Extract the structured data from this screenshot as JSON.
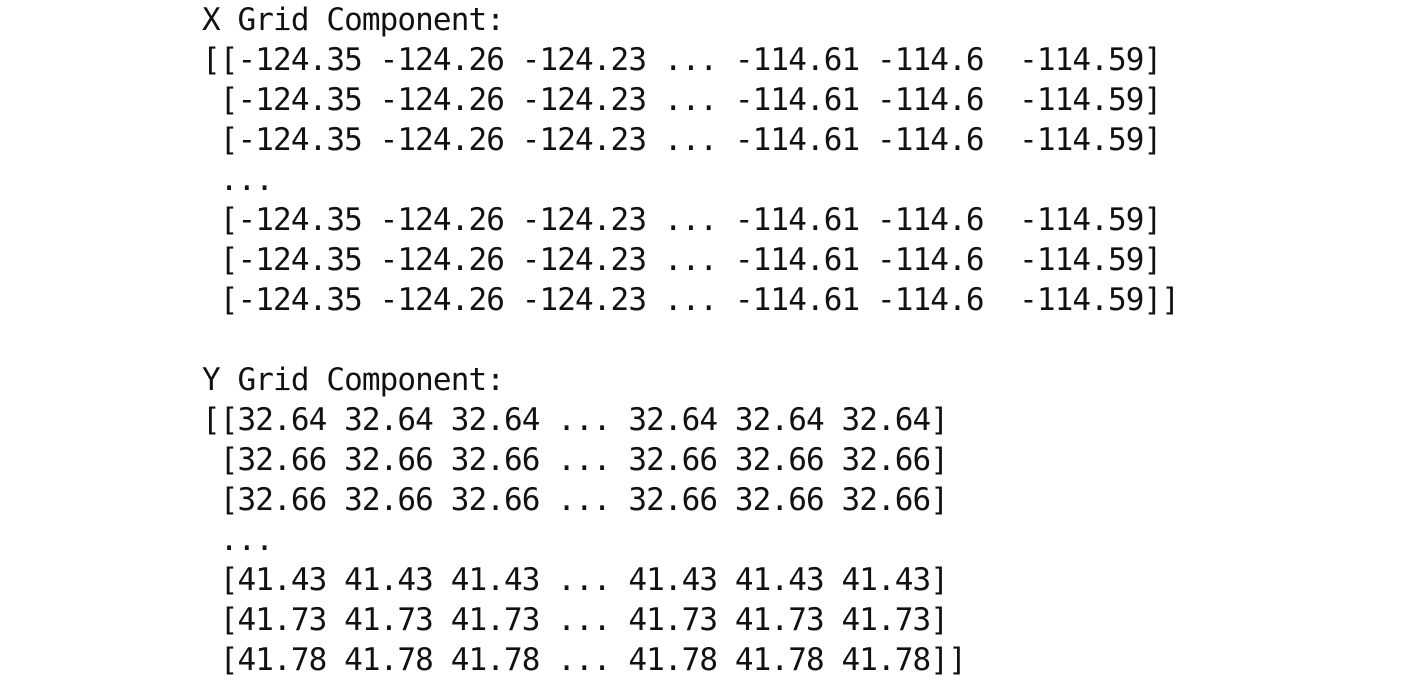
{
  "output": {
    "x_grid": {
      "heading": "X Grid Component:",
      "lines": [
        "[[-124.35 -124.26 -124.23 ... -114.61 -114.6  -114.59]",
        " [-124.35 -124.26 -124.23 ... -114.61 -114.6  -114.59]",
        " [-124.35 -124.26 -124.23 ... -114.61 -114.6  -114.59]",
        " ...",
        " [-124.35 -124.26 -124.23 ... -114.61 -114.6  -114.59]",
        " [-124.35 -124.26 -124.23 ... -114.61 -114.6  -114.59]",
        " [-124.35 -124.26 -124.23 ... -114.61 -114.6  -114.59]]"
      ]
    },
    "y_grid": {
      "heading": "Y Grid Component:",
      "lines": [
        "[[32.64 32.64 32.64 ... 32.64 32.64 32.64]",
        " [32.66 32.66 32.66 ... 32.66 32.66 32.66]",
        " [32.66 32.66 32.66 ... 32.66 32.66 32.66]",
        " ...",
        " [41.43 41.43 41.43 ... 41.43 41.43 41.43]",
        " [41.73 41.73 41.73 ... 41.73 41.73 41.73]",
        " [41.78 41.78 41.78 ... 41.78 41.78 41.78]]"
      ]
    }
  }
}
